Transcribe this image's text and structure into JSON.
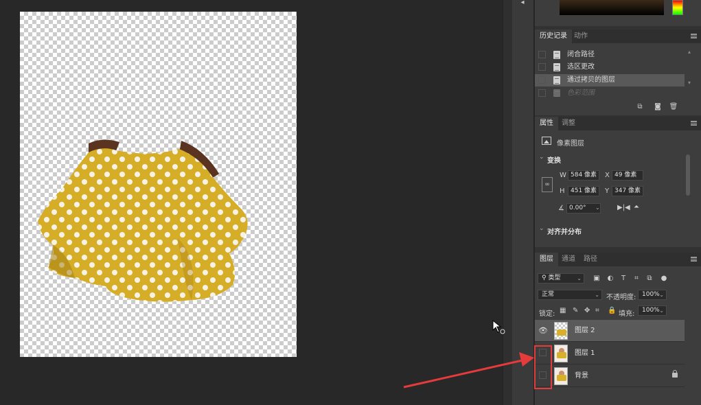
{
  "canvas": {
    "background": "#282828",
    "document_content": "yellow polka-dot shirt on transparent background"
  },
  "history": {
    "tabs": [
      "历史记录",
      "动作"
    ],
    "items": [
      {
        "label": "闭合路径",
        "selected": false,
        "dim": false
      },
      {
        "label": "选区更改",
        "selected": false,
        "dim": false
      },
      {
        "label": "通过拷贝的图层",
        "selected": true,
        "dim": false
      },
      {
        "label": "色彩范围",
        "selected": false,
        "dim": true
      }
    ]
  },
  "properties": {
    "tabs": [
      "属性",
      "调整"
    ],
    "layer_type": "像素图层",
    "transform_title": "变换",
    "w_label": "W",
    "w_value": "584 像素",
    "h_label": "H",
    "h_value": "451 像素",
    "x_label": "X",
    "x_value": "49 像素",
    "y_label": "Y",
    "y_value": "347 像素",
    "angle_value": "0.00°",
    "align_title": "对齐并分布"
  },
  "layers": {
    "tabs": [
      "图层",
      "通道",
      "路径"
    ],
    "filter_kind": "类型",
    "blend_mode": "正常",
    "opacity_label": "不透明度:",
    "opacity_value": "100%",
    "lock_label": "锁定:",
    "fill_label": "填充:",
    "fill_value": "100%",
    "items": [
      {
        "name": "图层 2",
        "visible": true,
        "selected": true,
        "locked": false
      },
      {
        "name": "图层 1",
        "visible": false,
        "selected": false,
        "locked": false
      },
      {
        "name": "背景",
        "visible": false,
        "selected": false,
        "locked": true
      }
    ]
  },
  "annotation": {
    "color": "#e53b3b"
  }
}
